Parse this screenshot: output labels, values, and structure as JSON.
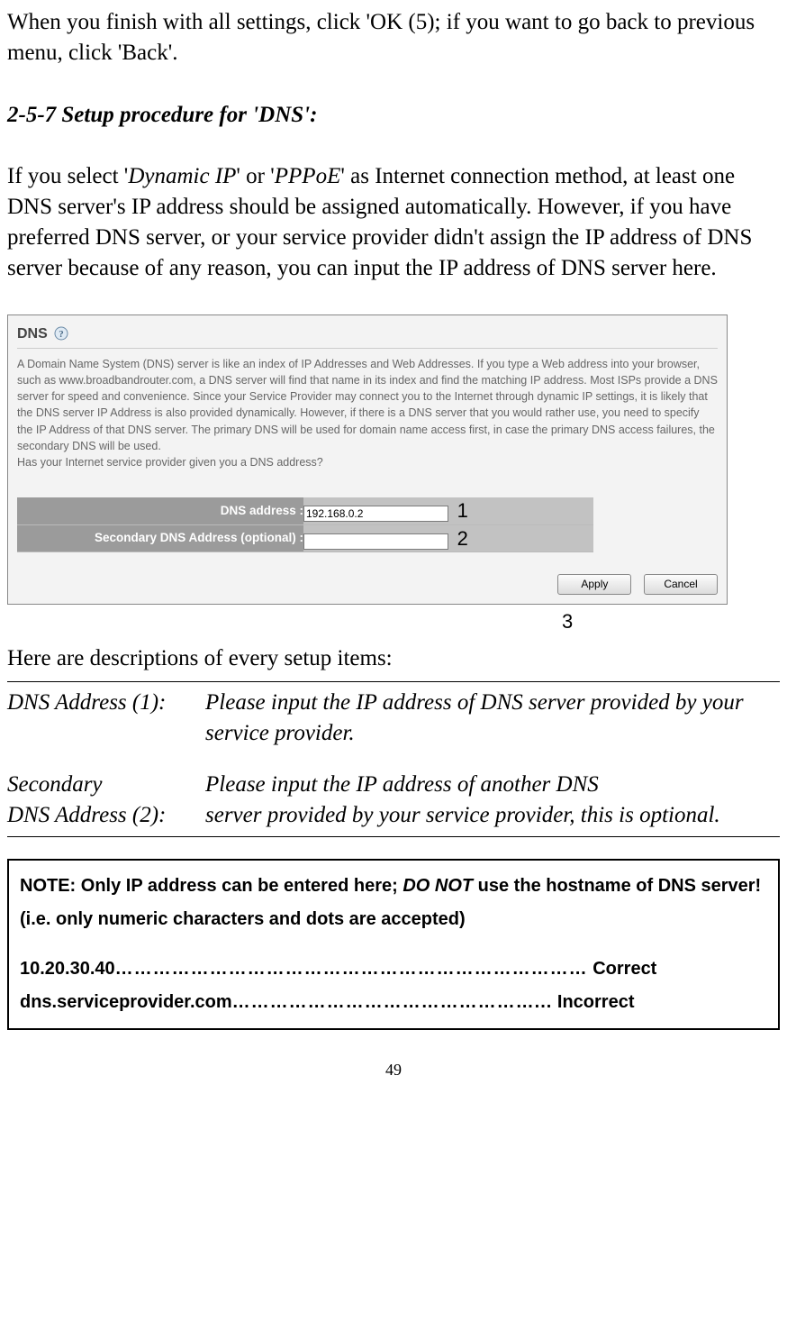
{
  "intro": "When you finish with all settings, click 'OK (5); if you want to go back to previous menu, click 'Back'.",
  "subheading": "2-5-7 Setup procedure for 'DNS':",
  "explain_prefix": "If you select '",
  "explain_dyn": "Dynamic IP",
  "explain_mid": "' or '",
  "explain_ppp": "PPPoE",
  "explain_suffix": "' as Internet connection method, at least one DNS server's IP address should be assigned automatically. However, if you have preferred DNS server, or your service provider didn't assign the IP address of DNS server because of any reason, you can input the IP address of DNS server here.",
  "screenshot": {
    "title": "DNS",
    "body": "A Domain Name System (DNS) server is like an index of IP Addresses and Web Addresses. If you type a Web address into your browser, such as www.broadbandrouter.com, a DNS server will find that name in its index and find the matching IP address. Most ISPs provide a DNS server for speed and convenience. Since your Service Provider may connect you to the Internet through dynamic IP settings, it is likely that the DNS server IP Address is also provided dynamically. However, if there is a DNS server that you would rather use, you need to specify the IP Address of that DNS server. The primary DNS will be used for domain name access first, in case the primary DNS access failures, the secondary DNS will be used.\nHas your Internet service provider given you a DNS address?",
    "row1_label": "DNS address :",
    "row1_value": "192.168.0.2",
    "row2_label": "Secondary DNS Address (optional) :",
    "row2_value": "",
    "apply": "Apply",
    "cancel": "Cancel"
  },
  "ann": {
    "one": "1",
    "two": "2",
    "three": "3"
  },
  "here_desc": "Here are descriptions of every setup items:",
  "descs": {
    "d1_label": "DNS Address (1):",
    "d1_text": "Please input the IP address of DNS server provided by your service provider.",
    "d2_label_l1": "Secondary",
    "d2_label_l2": "DNS Address (2):",
    "d2_text_l1": "Please input the IP address of another DNS",
    "d2_text_l2": "server provided by your service provider, this is optional."
  },
  "note": {
    "line1_pre": "NOTE: Only IP address can be entered here; ",
    "line1_donot": "DO NOT",
    "line1_post": " use the hostname of DNS server! (i.e. only numeric characters and dots are accepted)",
    "ex1_pre": "10.20.30.40",
    "ex1_dots": "…………………………………………………………………",
    "ex1_res": " Correct",
    "ex2_pre": "dns.serviceprovider.com",
    "ex2_dots": "…………………………………………...",
    "ex2_res": " Incorrect"
  },
  "page_number": "49"
}
